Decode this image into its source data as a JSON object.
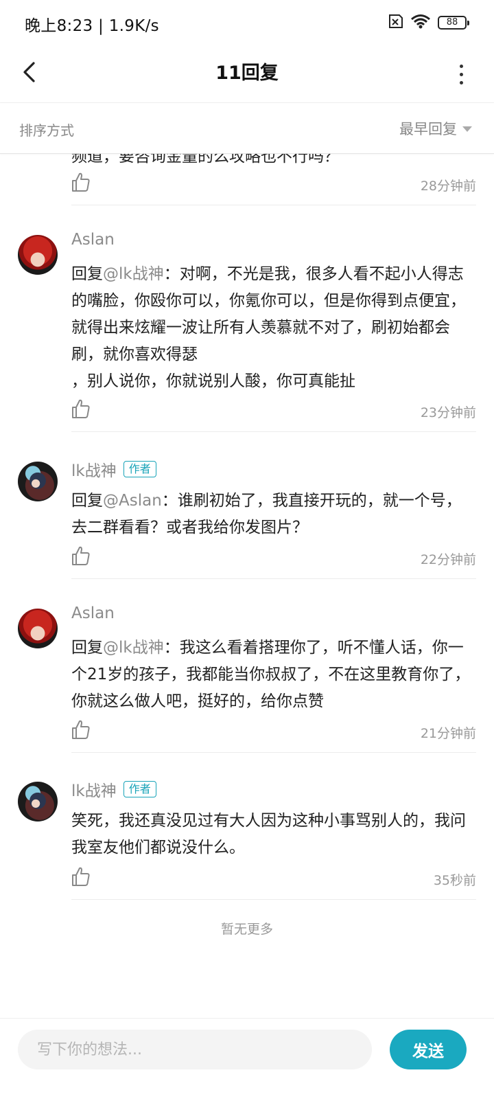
{
  "status_bar": {
    "time_speed": "晚上8:23 | 1.9K/s",
    "battery": "88",
    "icons": [
      "sim-off-icon",
      "wifi-icon",
      "battery-icon"
    ]
  },
  "header": {
    "title": "11回复",
    "back_icon": "back-arrow-icon",
    "more_icon": "more-vertical-icon"
  },
  "sort": {
    "label": "排序方式",
    "selected": "最早回复"
  },
  "clipped_comment": {
    "text_partial": "频道，要咨询金量的么攻略也不行吗？",
    "time": "28分钟前"
  },
  "comments": [
    {
      "author": "Aslan",
      "is_author": false,
      "reply_prefix": "回复",
      "mention": "@lk战神",
      "text": "：对啊，不光是我，很多人看不起小人得志的嘴脸，你殴你可以，你氪你可以，但是你得到点便宜，就得出来炫耀一波让所有人羡慕就不对了，刷初始都会刷，就你喜欢得瑟\n，别人说你，你就说别人酸，你可真能扯",
      "time": "23分钟前"
    },
    {
      "author": "lk战神",
      "is_author": true,
      "badge": "作者",
      "reply_prefix": "回复",
      "mention": "@Aslan",
      "text": "：谁刷初始了，我直接开玩的，就一个号，去二群看看？或者我给你发图片？",
      "time": "22分钟前"
    },
    {
      "author": "Aslan",
      "is_author": false,
      "reply_prefix": "回复",
      "mention": "@lk战神",
      "text": "：我这么看着搭理你了，听不懂人话，你一个21岁的孩子，我都能当你叔叔了，不在这里教育你了，你就这么做人吧，挺好的，给你点赞",
      "time": "21分钟前"
    },
    {
      "author": "lk战神",
      "is_author": true,
      "badge": "作者",
      "reply_prefix": "",
      "mention": "",
      "text": "笑死，我还真没见过有大人因为这种小事骂别人的，我问我室友他们都说没什么。",
      "time": "35秒前"
    }
  ],
  "footer": {
    "no_more": "暂无更多"
  },
  "compose": {
    "placeholder": "写下你的想法...",
    "send_label": "发送"
  },
  "colors": {
    "accent": "#1aa9c0",
    "muted_text": "#999999",
    "mention": "#8a8a8a"
  }
}
